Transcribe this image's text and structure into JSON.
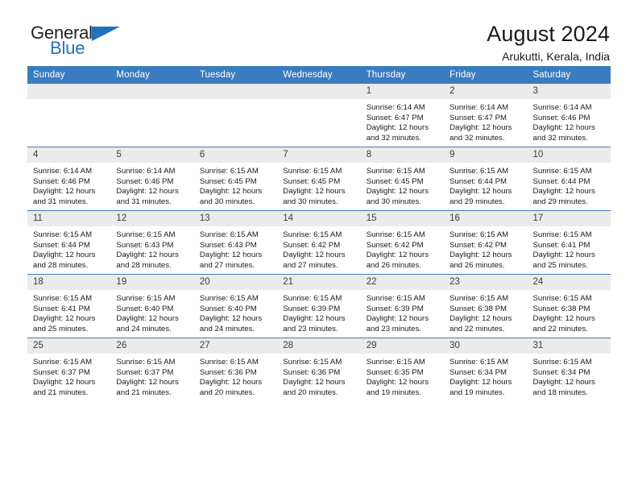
{
  "brand": {
    "name_top": "General",
    "name_bottom": "Blue",
    "accent_color": "#1f72bd",
    "triangle_icon": "triangle-icon"
  },
  "header": {
    "title": "August 2024",
    "subtitle": "Arukutti, Kerala, India"
  },
  "calendar": {
    "header_bg": "#3a7cbf",
    "daynum_bg": "#ebebeb",
    "weekdays": [
      "Sunday",
      "Monday",
      "Tuesday",
      "Wednesday",
      "Thursday",
      "Friday",
      "Saturday"
    ],
    "weeks": [
      [
        {
          "day": "",
          "empty": true
        },
        {
          "day": "",
          "empty": true
        },
        {
          "day": "",
          "empty": true
        },
        {
          "day": "",
          "empty": true
        },
        {
          "day": "1",
          "sunrise": "Sunrise: 6:14 AM",
          "sunset": "Sunset: 6:47 PM",
          "daylight_1": "Daylight: 12 hours",
          "daylight_2": "and 32 minutes."
        },
        {
          "day": "2",
          "sunrise": "Sunrise: 6:14 AM",
          "sunset": "Sunset: 6:47 PM",
          "daylight_1": "Daylight: 12 hours",
          "daylight_2": "and 32 minutes."
        },
        {
          "day": "3",
          "sunrise": "Sunrise: 6:14 AM",
          "sunset": "Sunset: 6:46 PM",
          "daylight_1": "Daylight: 12 hours",
          "daylight_2": "and 32 minutes."
        }
      ],
      [
        {
          "day": "4",
          "sunrise": "Sunrise: 6:14 AM",
          "sunset": "Sunset: 6:46 PM",
          "daylight_1": "Daylight: 12 hours",
          "daylight_2": "and 31 minutes."
        },
        {
          "day": "5",
          "sunrise": "Sunrise: 6:14 AM",
          "sunset": "Sunset: 6:46 PM",
          "daylight_1": "Daylight: 12 hours",
          "daylight_2": "and 31 minutes."
        },
        {
          "day": "6",
          "sunrise": "Sunrise: 6:15 AM",
          "sunset": "Sunset: 6:45 PM",
          "daylight_1": "Daylight: 12 hours",
          "daylight_2": "and 30 minutes."
        },
        {
          "day": "7",
          "sunrise": "Sunrise: 6:15 AM",
          "sunset": "Sunset: 6:45 PM",
          "daylight_1": "Daylight: 12 hours",
          "daylight_2": "and 30 minutes."
        },
        {
          "day": "8",
          "sunrise": "Sunrise: 6:15 AM",
          "sunset": "Sunset: 6:45 PM",
          "daylight_1": "Daylight: 12 hours",
          "daylight_2": "and 30 minutes."
        },
        {
          "day": "9",
          "sunrise": "Sunrise: 6:15 AM",
          "sunset": "Sunset: 6:44 PM",
          "daylight_1": "Daylight: 12 hours",
          "daylight_2": "and 29 minutes."
        },
        {
          "day": "10",
          "sunrise": "Sunrise: 6:15 AM",
          "sunset": "Sunset: 6:44 PM",
          "daylight_1": "Daylight: 12 hours",
          "daylight_2": "and 29 minutes."
        }
      ],
      [
        {
          "day": "11",
          "sunrise": "Sunrise: 6:15 AM",
          "sunset": "Sunset: 6:44 PM",
          "daylight_1": "Daylight: 12 hours",
          "daylight_2": "and 28 minutes."
        },
        {
          "day": "12",
          "sunrise": "Sunrise: 6:15 AM",
          "sunset": "Sunset: 6:43 PM",
          "daylight_1": "Daylight: 12 hours",
          "daylight_2": "and 28 minutes."
        },
        {
          "day": "13",
          "sunrise": "Sunrise: 6:15 AM",
          "sunset": "Sunset: 6:43 PM",
          "daylight_1": "Daylight: 12 hours",
          "daylight_2": "and 27 minutes."
        },
        {
          "day": "14",
          "sunrise": "Sunrise: 6:15 AM",
          "sunset": "Sunset: 6:42 PM",
          "daylight_1": "Daylight: 12 hours",
          "daylight_2": "and 27 minutes."
        },
        {
          "day": "15",
          "sunrise": "Sunrise: 6:15 AM",
          "sunset": "Sunset: 6:42 PM",
          "daylight_1": "Daylight: 12 hours",
          "daylight_2": "and 26 minutes."
        },
        {
          "day": "16",
          "sunrise": "Sunrise: 6:15 AM",
          "sunset": "Sunset: 6:42 PM",
          "daylight_1": "Daylight: 12 hours",
          "daylight_2": "and 26 minutes."
        },
        {
          "day": "17",
          "sunrise": "Sunrise: 6:15 AM",
          "sunset": "Sunset: 6:41 PM",
          "daylight_1": "Daylight: 12 hours",
          "daylight_2": "and 25 minutes."
        }
      ],
      [
        {
          "day": "18",
          "sunrise": "Sunrise: 6:15 AM",
          "sunset": "Sunset: 6:41 PM",
          "daylight_1": "Daylight: 12 hours",
          "daylight_2": "and 25 minutes."
        },
        {
          "day": "19",
          "sunrise": "Sunrise: 6:15 AM",
          "sunset": "Sunset: 6:40 PM",
          "daylight_1": "Daylight: 12 hours",
          "daylight_2": "and 24 minutes."
        },
        {
          "day": "20",
          "sunrise": "Sunrise: 6:15 AM",
          "sunset": "Sunset: 6:40 PM",
          "daylight_1": "Daylight: 12 hours",
          "daylight_2": "and 24 minutes."
        },
        {
          "day": "21",
          "sunrise": "Sunrise: 6:15 AM",
          "sunset": "Sunset: 6:39 PM",
          "daylight_1": "Daylight: 12 hours",
          "daylight_2": "and 23 minutes."
        },
        {
          "day": "22",
          "sunrise": "Sunrise: 6:15 AM",
          "sunset": "Sunset: 6:39 PM",
          "daylight_1": "Daylight: 12 hours",
          "daylight_2": "and 23 minutes."
        },
        {
          "day": "23",
          "sunrise": "Sunrise: 6:15 AM",
          "sunset": "Sunset: 6:38 PM",
          "daylight_1": "Daylight: 12 hours",
          "daylight_2": "and 22 minutes."
        },
        {
          "day": "24",
          "sunrise": "Sunrise: 6:15 AM",
          "sunset": "Sunset: 6:38 PM",
          "daylight_1": "Daylight: 12 hours",
          "daylight_2": "and 22 minutes."
        }
      ],
      [
        {
          "day": "25",
          "sunrise": "Sunrise: 6:15 AM",
          "sunset": "Sunset: 6:37 PM",
          "daylight_1": "Daylight: 12 hours",
          "daylight_2": "and 21 minutes."
        },
        {
          "day": "26",
          "sunrise": "Sunrise: 6:15 AM",
          "sunset": "Sunset: 6:37 PM",
          "daylight_1": "Daylight: 12 hours",
          "daylight_2": "and 21 minutes."
        },
        {
          "day": "27",
          "sunrise": "Sunrise: 6:15 AM",
          "sunset": "Sunset: 6:36 PM",
          "daylight_1": "Daylight: 12 hours",
          "daylight_2": "and 20 minutes."
        },
        {
          "day": "28",
          "sunrise": "Sunrise: 6:15 AM",
          "sunset": "Sunset: 6:36 PM",
          "daylight_1": "Daylight: 12 hours",
          "daylight_2": "and 20 minutes."
        },
        {
          "day": "29",
          "sunrise": "Sunrise: 6:15 AM",
          "sunset": "Sunset: 6:35 PM",
          "daylight_1": "Daylight: 12 hours",
          "daylight_2": "and 19 minutes."
        },
        {
          "day": "30",
          "sunrise": "Sunrise: 6:15 AM",
          "sunset": "Sunset: 6:34 PM",
          "daylight_1": "Daylight: 12 hours",
          "daylight_2": "and 19 minutes."
        },
        {
          "day": "31",
          "sunrise": "Sunrise: 6:15 AM",
          "sunset": "Sunset: 6:34 PM",
          "daylight_1": "Daylight: 12 hours",
          "daylight_2": "and 18 minutes."
        }
      ]
    ]
  }
}
